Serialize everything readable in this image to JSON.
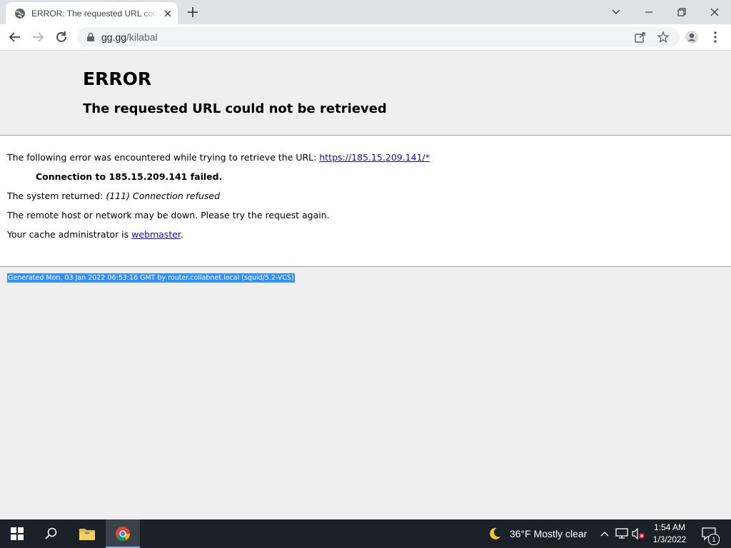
{
  "browser": {
    "tab_title": "ERROR: The requested URL could not be retrieved",
    "url_host": "gg.gg",
    "url_path": "/kilabal"
  },
  "page": {
    "title": "ERROR",
    "subtitle": "The requested URL could not be retrieved",
    "line1_prefix": "The following error was encountered while trying to retrieve the URL: ",
    "line1_link": "https://185.15.209.141/*",
    "connection_failed": "Connection to 185.15.209.141 failed.",
    "system_returned_prefix": "The system returned: ",
    "system_returned_value": "(111) Connection refused",
    "remote_host_msg": "The remote host or network may be down. Please try the request again.",
    "cache_admin_prefix": "Your cache administrator is ",
    "cache_admin_link": "webmaster",
    "cache_admin_suffix": ".",
    "generated": "Generated Mon, 03 Jan 2022 06:53:16 GMT by router.collabnet.local (squid/5.2-VCS)"
  },
  "taskbar": {
    "weather": "36°F  Mostly clear",
    "time": "1:54 AM",
    "date": "1/3/2022",
    "notification_count": "1"
  },
  "icons": {
    "tab": "globe-icon",
    "lock": "lock-icon",
    "share": "share-icon",
    "bookmark": "star-icon",
    "profile": "profile-icon",
    "weather": "moon-icon"
  },
  "colors": {
    "link": "#1a0dab",
    "selection": "#3390ff",
    "taskbar": "#1b2128"
  }
}
